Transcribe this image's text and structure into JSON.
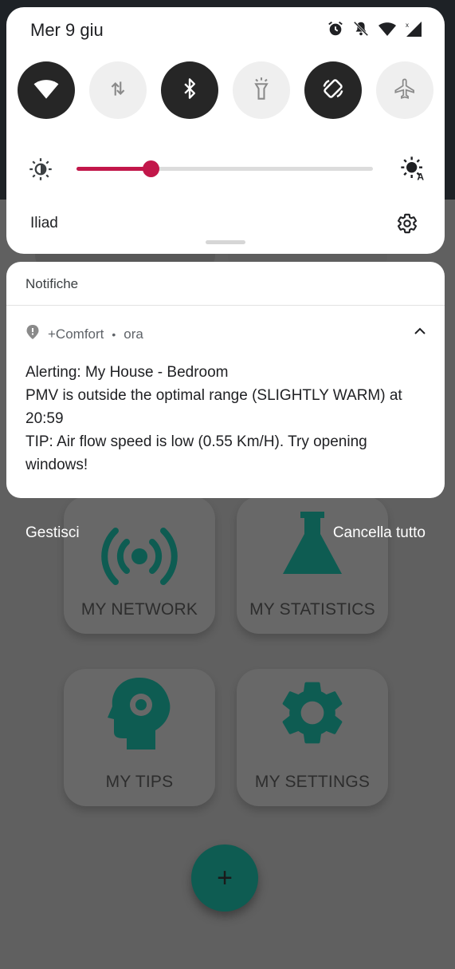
{
  "status_bar": {
    "date": "Mer 9 giu",
    "icons": [
      "alarm-icon",
      "silent-icon",
      "wifi-icon",
      "signal-icon"
    ]
  },
  "quick_settings": {
    "tiles": [
      {
        "name": "wifi",
        "icon": "wifi-icon",
        "state": "on"
      },
      {
        "name": "mobile-data",
        "icon": "data-transfer-icon",
        "state": "off"
      },
      {
        "name": "bluetooth",
        "icon": "bluetooth-icon",
        "state": "on"
      },
      {
        "name": "flashlight",
        "icon": "flashlight-icon",
        "state": "off"
      },
      {
        "name": "auto-rotate",
        "icon": "rotate-icon",
        "state": "on"
      },
      {
        "name": "airplane-mode",
        "icon": "airplane-icon",
        "state": "off"
      }
    ],
    "brightness_level": 0.25,
    "accent_color": "#c2174a",
    "carrier": "Iliad"
  },
  "notifications": {
    "header": "Notifiche",
    "items": [
      {
        "app": "+Comfort",
        "separator": "•",
        "time": "ora",
        "title": "Alerting: My House - Bedroom",
        "line1": "PMV is outside the optimal range (SLIGHTLY WARM) at 20:59",
        "line2": "TIP: Air flow speed is low (0.55 Km/H). Try opening windows!"
      }
    ],
    "manage_label": "Gestisci",
    "clear_all_label": "Cancella tutto"
  },
  "background_app": {
    "accent_color": "#0e5c52",
    "tiles": [
      {
        "label": "MY NETWORK",
        "icon": "broadcast-icon"
      },
      {
        "label": "MY STATISTICS",
        "icon": "flask-icon"
      },
      {
        "label": "MY TIPS",
        "icon": "head-gear-icon"
      },
      {
        "label": "MY SETTINGS",
        "icon": "settings-gear-icon"
      }
    ],
    "fab_label": "+"
  }
}
